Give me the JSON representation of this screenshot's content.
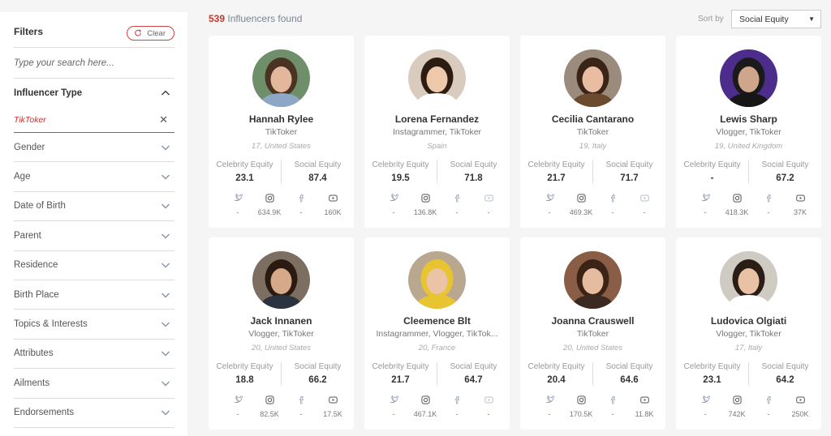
{
  "sidebar": {
    "title": "Filters",
    "clear_label": "Clear",
    "search_placeholder": "Type your search here...",
    "influencer_type": {
      "label": "Influencer Type",
      "selected": "TikToker"
    },
    "filters": [
      "Gender",
      "Age",
      "Date of Birth",
      "Parent",
      "Residence",
      "Birth Place",
      "Topics & Interests",
      "Attributes",
      "Ailments",
      "Endorsements"
    ]
  },
  "header": {
    "count": "539",
    "found_label": "Influencers found",
    "sort_label": "Sort by",
    "sort_value": "Social Equity"
  },
  "labels": {
    "celebrity": "Celebrity Equity",
    "social": "Social Equity"
  },
  "colors": {
    "accent": "#c0392b",
    "chevron": "#8a97a8",
    "icon": "#8a97a8"
  },
  "cards": [
    {
      "name": "Hannah Rylee",
      "type": "TikToker",
      "location": "17, United States",
      "celebrity": "23.1",
      "social": "87.4",
      "twitter": "-",
      "instagram": "634.9K",
      "facebook": "-",
      "youtube": "160K"
    },
    {
      "name": "Lorena Fernandez",
      "type": "Instagrammer, TikToker",
      "location": "Spain",
      "celebrity": "19.5",
      "social": "71.8",
      "twitter": "-",
      "instagram": "136.8K",
      "facebook": "-",
      "youtube": "-"
    },
    {
      "name": "Cecilia Cantarano",
      "type": "TikToker",
      "location": "19, Italy",
      "celebrity": "21.7",
      "social": "71.7",
      "twitter": "-",
      "instagram": "469.3K",
      "facebook": "-",
      "youtube": "-"
    },
    {
      "name": "Lewis Sharp",
      "type": "Vlogger, TikToker",
      "location": "19, United Kingdom",
      "celebrity": "-",
      "social": "67.2",
      "twitter": "-",
      "instagram": "418.3K",
      "facebook": "-",
      "youtube": "37K"
    },
    {
      "name": "Jack Innanen",
      "type": "Vlogger, TikToker",
      "location": "20, United States",
      "celebrity": "18.8",
      "social": "66.2",
      "twitter": "-",
      "instagram": "82.5K",
      "facebook": "-",
      "youtube": "17.5K"
    },
    {
      "name": "Cleemence Blt",
      "type": "Instagrammer, Vlogger, TikTok...",
      "location": "20, France",
      "celebrity": "21.7",
      "social": "64.7",
      "twitter": "-",
      "instagram": "467.1K",
      "facebook": "-",
      "youtube": "-"
    },
    {
      "name": "Joanna Crauswell",
      "type": "TikToker",
      "location": "20, United States",
      "celebrity": "20.4",
      "social": "64.6",
      "twitter": "-",
      "instagram": "170.5K",
      "facebook": "-",
      "youtube": "11.8K"
    },
    {
      "name": "Ludovica Olgiati",
      "type": "Vlogger, TikToker",
      "location": "17, Italy",
      "celebrity": "23.1",
      "social": "64.2",
      "twitter": "-",
      "instagram": "742K",
      "facebook": "-",
      "youtube": "250K"
    }
  ]
}
